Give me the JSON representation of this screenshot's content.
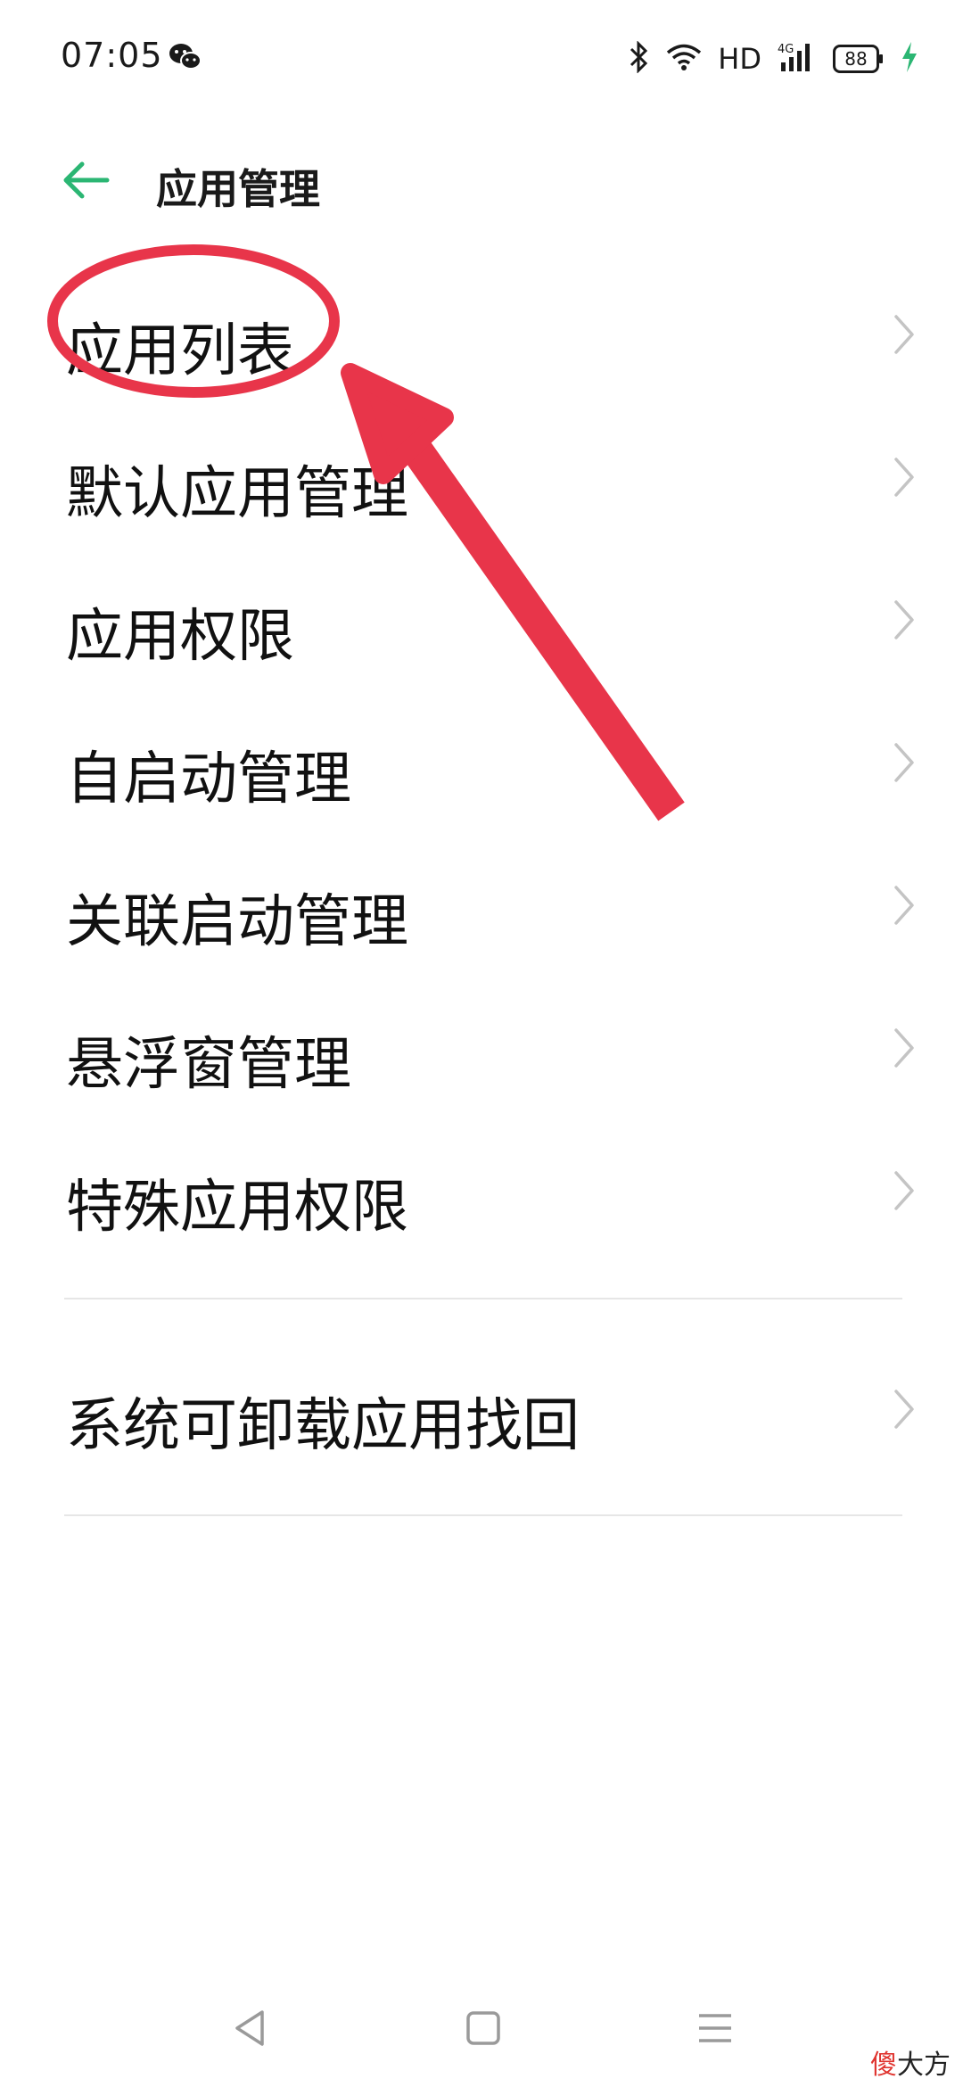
{
  "status_bar": {
    "time": "07:05",
    "notification_icon": "wechat-icon",
    "icons": [
      "bluetooth-icon",
      "wifi-icon",
      "4g-signal-icon",
      "battery-icon",
      "charging-icon"
    ],
    "hd_label": "HD",
    "battery_level": "88"
  },
  "header": {
    "back_icon": "arrow-left-icon",
    "title": "应用管理"
  },
  "menu": {
    "items": [
      {
        "label": "应用列表"
      },
      {
        "label": "默认应用管理"
      },
      {
        "label": "应用权限"
      },
      {
        "label": "自启动管理"
      },
      {
        "label": "关联启动管理"
      },
      {
        "label": "悬浮窗管理"
      },
      {
        "label": "特殊应用权限"
      },
      {
        "label": "系统可卸载应用找回"
      }
    ]
  },
  "nav_bar": {
    "buttons": [
      "back-triangle-icon",
      "home-square-icon",
      "menu-lines-icon"
    ]
  },
  "watermark": {
    "char1": "傻",
    "char2": "大方"
  },
  "colors": {
    "accent": "#2bb673",
    "annotation": "#e8354a"
  }
}
